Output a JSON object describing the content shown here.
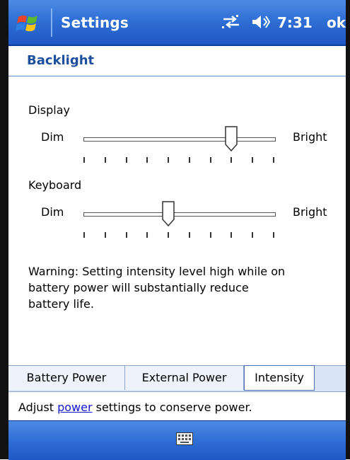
{
  "titlebar": {
    "title": "Settings",
    "clock": "7:31",
    "ok_label": "ok"
  },
  "page": {
    "title": "Backlight"
  },
  "display": {
    "label": "Display",
    "min_label": "Dim",
    "max_label": "Bright",
    "level": 7,
    "levels": 10
  },
  "keyboard": {
    "label": "Keyboard",
    "min_label": "Dim",
    "max_label": "Bright",
    "level": 4,
    "levels": 10
  },
  "warning": {
    "line1": "Warning: Setting intensity level high while on",
    "line2": "battery power will substantially reduce",
    "line3": "battery life."
  },
  "tabs": [
    {
      "label": "Battery Power",
      "active": false
    },
    {
      "label": "External Power",
      "active": false
    },
    {
      "label": "Intensity",
      "active": true
    }
  ],
  "hint": {
    "prefix": "Adjust ",
    "link": "power",
    "suffix": " settings to conserve power."
  },
  "colors": {
    "titlebar_blue": "#2f6fd6",
    "header_text": "#1d4f9c",
    "link": "#1515d6"
  },
  "icons": {
    "start": "windows-flag-icon",
    "connectivity": "connectivity-arrows-icon",
    "volume": "speaker-volume-icon",
    "keyboard": "keyboard-icon"
  }
}
